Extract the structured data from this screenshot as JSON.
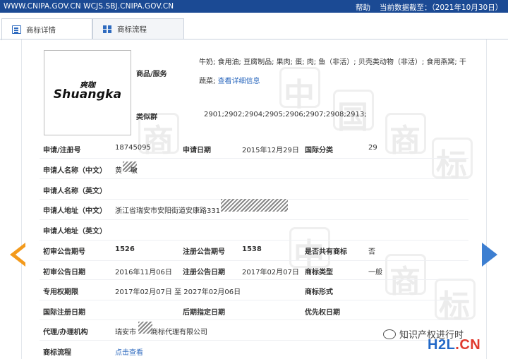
{
  "topbar": {
    "site": "WWW.CNIPA.GOV.CN  WCJS.SBJ.CNIPA.GOV.CN",
    "help": "帮助",
    "date": "当前数据截至：（2021年10月30日）"
  },
  "tabs": [
    {
      "label": "商标详情"
    },
    {
      "label": "商标流程"
    }
  ],
  "logo": {
    "cn": "爽咖",
    "en": "Shuangka"
  },
  "goods": {
    "label": "商品/服务",
    "text": "牛奶; 食用油; 豆腐制品; 果肉; 蛋; 肉; 鱼（非活）; 贝壳类动物（非活）; 食用燕窝; 干蔬菜;",
    "link": "查看详细信息"
  },
  "similar": {
    "label": "类似群",
    "value": "2901;2902;2904;2905;2906;2907;2908;2913;"
  },
  "fields": {
    "reg_no_label": "申请/注册号",
    "reg_no": "18745095",
    "app_date_label": "申请日期",
    "app_date": "2015年12月29日",
    "intl_class_label": "国际分类",
    "intl_class": "29",
    "applicant_cn_label": "申请人名称（中文）",
    "applicant_cn_a": "黄",
    "applicant_cn_b": "敏",
    "applicant_en_label": "申请人名称（英文）",
    "address_cn_label": "申请人地址（中文）",
    "address_cn": "浙江省瑞安市安阳街道安康路331",
    "address_en_label": "申请人地址（英文）",
    "prelim_no_label": "初审公告期号",
    "prelim_no": "1526",
    "reg_pub_no_label": "注册公告期号",
    "reg_pub_no": "1538",
    "shared_label": "是否共有商标",
    "shared": "否",
    "prelim_date_label": "初审公告日期",
    "prelim_date": "2016年11月06日",
    "reg_pub_date_label": "注册公告日期",
    "reg_pub_date": "2017年02月07日",
    "type_label": "商标类型",
    "type": "一般",
    "term_label": "专用权期限",
    "term": "2017年02月07日 至 2027年02月06日",
    "form_label": "商标形式",
    "intl_reg_date_label": "国际注册日期",
    "later_date_label": "后期指定日期",
    "priority_date_label": "优先权日期",
    "agent_label": "代理/办理机构",
    "agent_a": "瑞安市",
    "agent_b": "商标代理有限公司",
    "flow_label": "商标流程",
    "flow_link": "点击查看"
  },
  "watermark": {
    "chars": [
      "中",
      "国",
      "商",
      "标"
    ]
  },
  "brand_overlay": {
    "wechat": "知识产权进行时",
    "site_a": "H2L",
    "site_b": ".CN"
  }
}
